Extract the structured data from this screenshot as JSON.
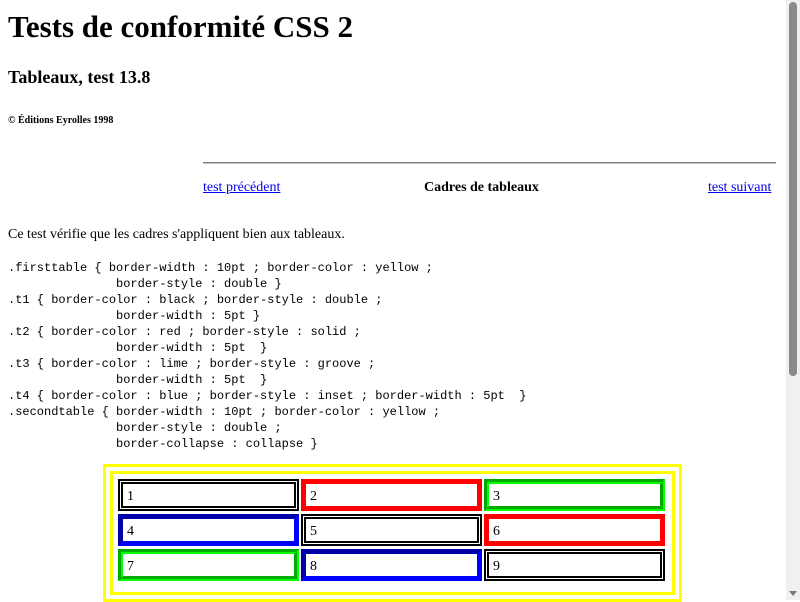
{
  "header": {
    "title": "Tests de conformité CSS 2",
    "subtitle": "Tableaux, test 13.8",
    "copyright": "© Éditions Eyrolles 1998"
  },
  "nav": {
    "prev_label": "test précédent",
    "section_title": "Cadres de tableaux",
    "next_label": "test suivant"
  },
  "intro": "Ce test vérifie que les cadres s'appliquent bien aux tableaux.",
  "css_code": [
    ".firsttable { border-width : 10pt ; border-color : yellow ;",
    "               border-style : double }",
    ".t1 { border-color : black ; border-style : double ;",
    "               border-width : 5pt }",
    ".t2 { border-color : red ; border-style : solid ;",
    "               border-width : 5pt  }",
    ".t3 { border-color : lime ; border-style : groove ;",
    "               border-width : 5pt  }",
    ".t4 { border-color : blue ; border-style : inset ; border-width : 5pt  }",
    ".secondtable { border-width : 10pt ; border-color : yellow ;",
    "               border-style : double ;",
    "               border-collapse : collapse }"
  ],
  "table": {
    "cells": [
      {
        "text": "1",
        "style": "t1"
      },
      {
        "text": "2",
        "style": "t2"
      },
      {
        "text": "3",
        "style": "t3"
      },
      {
        "text": "4",
        "style": "t4"
      },
      {
        "text": "5",
        "style": "t1"
      },
      {
        "text": "6",
        "style": "t2"
      },
      {
        "text": "7",
        "style": "t3"
      },
      {
        "text": "8",
        "style": "t4"
      },
      {
        "text": "9",
        "style": "t1"
      }
    ],
    "colors": {
      "outer": "#ffff00",
      "t1": "#000000",
      "t2": "#ff0000",
      "t3": "#00ff00",
      "t4": "#0000ff"
    }
  },
  "scrollbar": {
    "thumb_icon": "scroll-thumb",
    "down_icon": "scroll-down-arrow-icon"
  }
}
